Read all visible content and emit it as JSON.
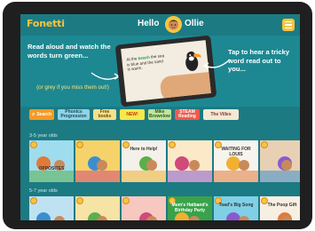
{
  "app": {
    "logo": "Fonetti"
  },
  "header": {
    "greeting": "Hello",
    "user_name": "Ollie"
  },
  "hero": {
    "left_text": "Read aloud and watch the words turn green...",
    "left_subtext": "(or grey if you miss them out!)",
    "right_text": "Tap to hear a tricky word read out to you...",
    "device_text_before": "At the ",
    "device_text_green": "beach",
    "device_text_after": " the sea is blue and the sand is warm."
  },
  "filters": {
    "search_label": "Search",
    "items": [
      {
        "label": "Phonics Progression",
        "bg": "#8fd3e6",
        "color": "#1a4b58"
      },
      {
        "label": "Free books",
        "bg": "#f6e08a",
        "color": "#6a4a10"
      },
      {
        "label": "NEW!",
        "bg": "#f7e84a",
        "color": "#c23a1c"
      },
      {
        "label": "Mike Brownlow",
        "bg": "#bfe5a0",
        "color": "#2f5a1c"
      },
      {
        "label": "STEAM Reading",
        "bg": "#ef5a4c",
        "color": "#ffffff"
      },
      {
        "label": "The Villes",
        "bg": "#f4e8d4",
        "color": "#7a3a2a"
      }
    ]
  },
  "sections": [
    {
      "label": "3-5 year olds",
      "books": [
        {
          "title": "OPPOSITES",
          "bg": "#9fdcee"
        },
        {
          "title": "",
          "bg": "#f6d36a"
        },
        {
          "title": "Here to Help!",
          "bg": "#f4f0ea"
        },
        {
          "title": "",
          "bg": "#fbe9c8"
        },
        {
          "title": "WAITING FOR LOUIS",
          "bg": "#f7f4ee"
        },
        {
          "title": "",
          "bg": "#e8d0b4"
        }
      ]
    },
    {
      "label": "5-7 year olds",
      "books": [
        {
          "title": "",
          "bg": "#bfe2f2"
        },
        {
          "title": "",
          "bg": "#f6e3a6"
        },
        {
          "title": "",
          "bg": "#f6c8c0"
        },
        {
          "title": "Mum's Hatband's Birthday Party",
          "bg": "#3aa24a"
        },
        {
          "title": "Toad's Big Song",
          "bg": "#7fd0e6"
        },
        {
          "title": "The Poop Gift",
          "bg": "#f7efe2"
        }
      ]
    }
  ],
  "colors": {
    "brand": "#f5c542",
    "screen_bg": "#1c7a83",
    "search_chip": "#f39a25"
  }
}
